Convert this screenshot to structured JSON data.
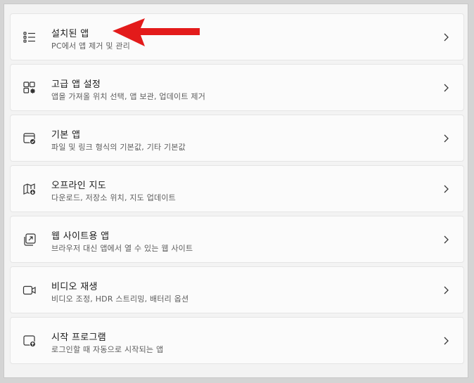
{
  "items": [
    {
      "title": "설치된 앱",
      "subtitle": "PC에서 앱 제거 및 관리",
      "icon": "installed-apps-list-icon"
    },
    {
      "title": "고급 앱 설정",
      "subtitle": "앱을 가져올 위치 선택, 앱 보관, 업데이트 제거",
      "icon": "advanced-app-settings-icon"
    },
    {
      "title": "기본 앱",
      "subtitle": "파일 및 링크 형식의 기본값, 기타 기본값",
      "icon": "default-apps-icon"
    },
    {
      "title": "오프라인 지도",
      "subtitle": "다운로드, 저장소 위치, 지도 업데이트",
      "icon": "offline-maps-icon"
    },
    {
      "title": "웹 사이트용 앱",
      "subtitle": "브라우저 대신 앱에서 열 수 있는 웹 사이트",
      "icon": "apps-for-websites-icon"
    },
    {
      "title": "비디오 재생",
      "subtitle": "비디오 조정, HDR 스트리밍, 배터리 옵션",
      "icon": "video-camera-icon"
    },
    {
      "title": "시작 프로그램",
      "subtitle": "로그인할 때 자동으로 시작되는 앱",
      "icon": "startup-icon"
    }
  ],
  "annotation": {
    "type": "red-arrow",
    "color": "#e31b1b",
    "points_to": "설치된 앱"
  },
  "colors": {
    "background": "#f3f3f3",
    "card": "#fbfbfb",
    "text": "#1a1a1a",
    "subtext": "#5c5c5c"
  }
}
